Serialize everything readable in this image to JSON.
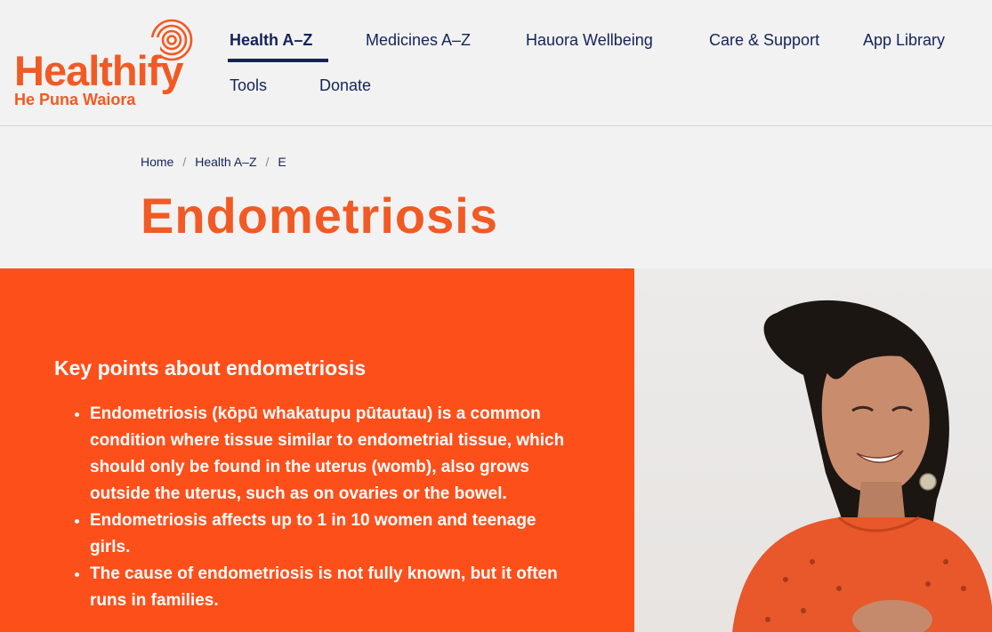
{
  "logo": {
    "wordmark": "Healthify",
    "subline": "He Puna Waiora"
  },
  "nav": {
    "items": [
      {
        "label": "Health A–Z",
        "active": true
      },
      {
        "label": "Medicines A–Z"
      },
      {
        "label": "Hauora Wellbeing"
      },
      {
        "label": "Care & Support"
      },
      {
        "label": "App Library"
      },
      {
        "label": "Tools"
      },
      {
        "label": "Donate"
      }
    ]
  },
  "breadcrumb": {
    "items": [
      "Home",
      "Health A–Z",
      "E"
    ],
    "separator": "/"
  },
  "page": {
    "title": "Endometriosis"
  },
  "key_points": {
    "title": "Key points about endometriosis",
    "items": [
      "Endometriosis (kōpū whakatupu pūtautau) is a common condition where tissue similar to endometrial tissue, which should only be found in the uterus (womb), also grows outside the uterus, such as on ovaries or the bowel.",
      "Endometriosis affects up to 1 in 10 women and teenage girls.",
      "The cause of endometriosis is not fully known, but it often runs in families."
    ]
  },
  "colors": {
    "brand_orange": "#f15a24",
    "panel_orange": "#fd4f1a",
    "navy": "#14235a",
    "background": "#f2f2f2"
  }
}
